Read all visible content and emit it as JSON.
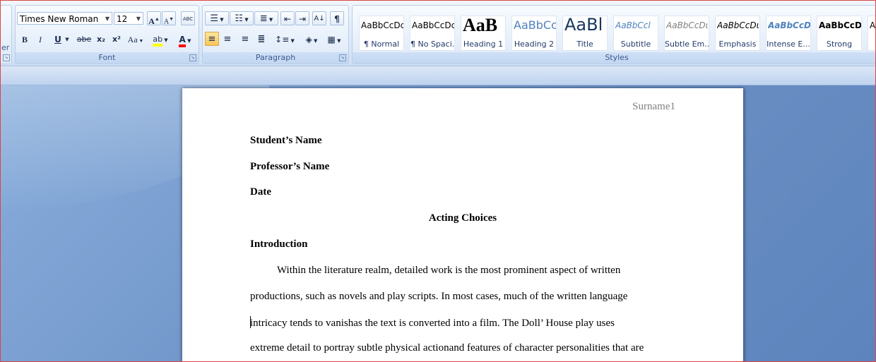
{
  "ribbon": {
    "edge_label": "er",
    "font": {
      "group_label": "Font",
      "font_name": "Times New Roman",
      "font_size": "12",
      "grow_label": "A",
      "shrink_label": "A",
      "clear_label": "ABC",
      "bold_label": "B",
      "italic_label": "I",
      "underline_label": "U",
      "strike_label": "abe",
      "subscript_label": "x₂",
      "superscript_label": "x²",
      "case_label": "Aa",
      "highlight_label": "ab",
      "fontcolor_label": "A"
    },
    "paragraph": {
      "group_label": "Paragraph",
      "pilcrow": "¶"
    },
    "styles": {
      "group_label": "Styles",
      "items": [
        {
          "sample": "AaBbCcDc",
          "name": "¶ Normal"
        },
        {
          "sample": "AaBbCcDc",
          "name": "¶ No Spaci..."
        },
        {
          "sample": "AaB",
          "name": "Heading 1"
        },
        {
          "sample": "AaBbCc",
          "name": "Heading 2"
        },
        {
          "sample": "AaBl",
          "name": "Title"
        },
        {
          "sample": "AaBbCcl",
          "name": "Subtitle"
        },
        {
          "sample": "AaBbCcDι",
          "name": "Subtle Em..."
        },
        {
          "sample": "AaBbCcDι",
          "name": "Emphasis"
        },
        {
          "sample": "AaBbCcDι",
          "name": "Intense E..."
        },
        {
          "sample": "AaBbCcDc",
          "name": "Strong"
        },
        {
          "sample": "A",
          "name": ""
        }
      ]
    }
  },
  "document": {
    "header": "Surname1",
    "student": "Student’s Name",
    "professor": "Professor’s Name",
    "date": "Date",
    "title": "Acting Choices",
    "section": "Introduction",
    "paragraph_lines": [
      "Within the literature realm, detailed work is the most prominent aspect of written",
      "productions, such as novels and play scripts. In most cases, much of the written language",
      "intricacy tends to vanishas the text is converted into a film. The Doll’ House play uses",
      "extreme detail to portray subtle physical actionand features of character personalities that are"
    ]
  },
  "colors": {
    "highlight": "#ffff00",
    "font_color": "#ff0000",
    "frame_border": "#dd4444"
  }
}
